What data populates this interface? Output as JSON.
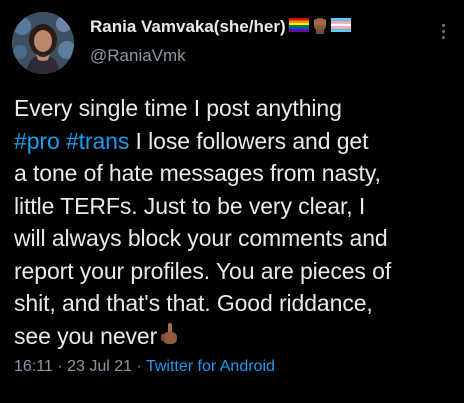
{
  "author": {
    "display_name": "Rania Vamvaka(she/her)",
    "handle": "@RaniaVmk",
    "name_emojis": [
      "rainbow-flag-icon",
      "raised-fist-medium-dark-skin-icon",
      "transgender-flag-icon"
    ]
  },
  "tweet": {
    "lines": [
      {
        "text": "Every single time I post anything"
      },
      {
        "hashtag1": "#pro",
        "hashtag2": "#trans",
        "rest": " I lose followers and get"
      },
      {
        "text": "a tone of hate messages from nasty,"
      },
      {
        "text": "little TERFs. Just to be very clear, I"
      },
      {
        "text": "will always block your comments and"
      },
      {
        "text": "report your profiles. You are pieces of"
      },
      {
        "text": "shit, and that's that. Good riddance,"
      },
      {
        "text": "see you never",
        "trailing_emoji": "middle-finger-medium-dark-skin-icon"
      }
    ]
  },
  "meta": {
    "time": "16:11",
    "separator": " · ",
    "date": "23 Jul 21",
    "source": "Twitter for Android"
  },
  "colors": {
    "background": "#000000",
    "text": "#e7e9ea",
    "secondary": "#8b98a5",
    "link": "#1d9bf0"
  }
}
